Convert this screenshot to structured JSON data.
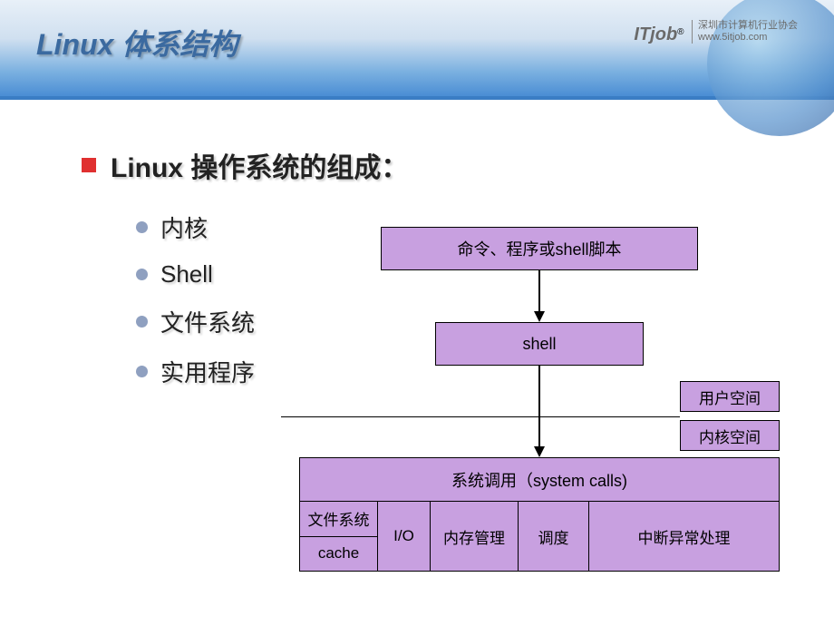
{
  "header": {
    "title": "Linux 体系结构",
    "logo_name": "ITjob",
    "logo_reg": "®",
    "logo_sub_cn": "深圳市计算机行业协会",
    "logo_sub_url": "www.5itjob.com"
  },
  "heading": "Linux 操作系统的组成：",
  "bullets": {
    "b1": "内核",
    "b2": "Shell",
    "b3": "文件系统",
    "b4": "实用程序"
  },
  "diagram": {
    "top_box": "命令、程序或shell脚本",
    "shell_box": "shell",
    "user_space": "用户空间",
    "kernel_space": "内核空间",
    "syscalls": "系统调用（system calls)",
    "fs": "文件系统",
    "cache": "cache",
    "io": "I/O",
    "mem": "内存管理",
    "sched": "调度",
    "irq": "中断异常处理"
  }
}
